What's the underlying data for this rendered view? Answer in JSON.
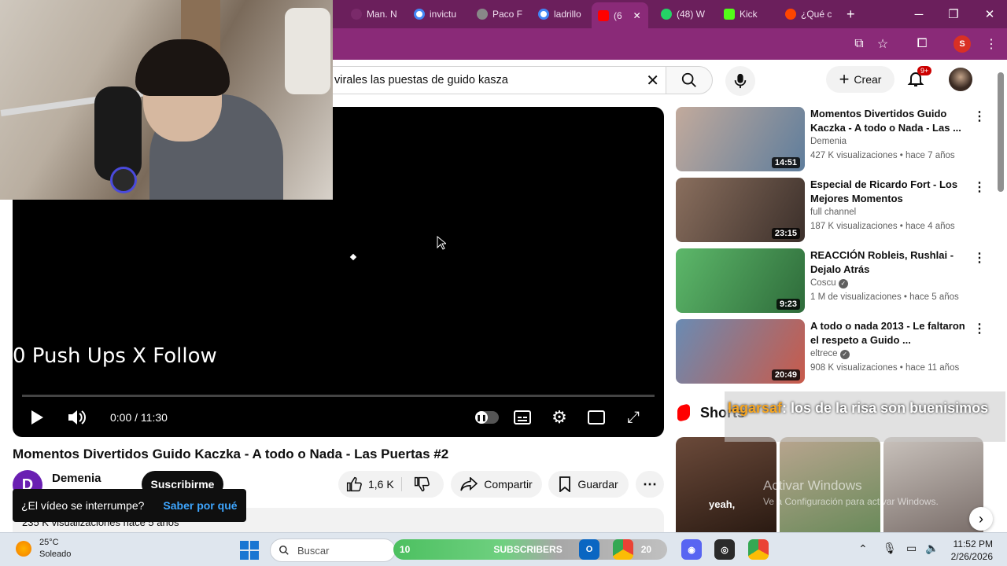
{
  "browser": {
    "tabs": [
      {
        "label": "Man. N",
        "color": "#7a2a6a"
      },
      {
        "label": "invictu",
        "color": "#4285f4"
      },
      {
        "label": "Paco F",
        "color": "#888888"
      },
      {
        "label": "ladrillo",
        "color": "#4285f4"
      },
      {
        "label": "(6",
        "color": "#ff0000"
      },
      {
        "label": "(48) W",
        "color": "#25d366"
      },
      {
        "label": "Kick",
        "color": "#53fc18"
      },
      {
        "label": "¿Qué c",
        "color": "#ff4500"
      }
    ],
    "profile_letter": "S"
  },
  "youtube": {
    "search_value": "virales las puestas de guido kasza",
    "create_label": "Crear",
    "notif_badge": "9+"
  },
  "player": {
    "overlay_text": "0 Push Ups X Follow",
    "time": "0:00 / 11:30"
  },
  "video": {
    "title": "Momentos Divertidos Guido Kaczka - A todo o Nada - Las Puertas #2",
    "channel": "Demenia",
    "subscribe_label": "Suscribirme",
    "likes": "1,6 K",
    "share_label": "Compartir",
    "save_label": "Guardar",
    "views_partial": "235 K visualizaciones  hace 5 años",
    "toast_text": "¿El vídeo se interrumpe?",
    "toast_link": "Saber por qué"
  },
  "recommended": [
    {
      "title": "Momentos Divertidos Guido Kaczka - A todo o Nada - Las ...",
      "channel": "Demenia",
      "verified": false,
      "meta": "427 K visualizaciones • hace 7 años",
      "duration": "14:51",
      "colors": [
        "#b8a59a",
        "#5e7d9c"
      ]
    },
    {
      "title": "Especial de Ricardo Fort - Los Mejores Momentos",
      "channel": "full channel",
      "verified": false,
      "meta": "187 K visualizaciones • hace 4 años",
      "duration": "23:15",
      "colors": [
        "#8a6f5e",
        "#3b2f2a"
      ]
    },
    {
      "title": "REACCIÓN Robleis, Rushlai - Dejalo Atrás",
      "channel": "Coscu",
      "verified": true,
      "meta": "1 M de visualizaciones • hace 5 años",
      "duration": "9:23",
      "colors": [
        "#5db86a",
        "#2e6b3a"
      ]
    },
    {
      "title": "A todo o nada 2013 - Le faltaron el respeto a Guido ...",
      "channel": "eltrece",
      "verified": true,
      "meta": "908 K visualizaciones • hace 11 años",
      "duration": "20:49",
      "colors": [
        "#6a8bb3",
        "#c95a4a"
      ]
    }
  ],
  "shorts": {
    "label": "Shorts",
    "items": [
      {
        "caption": "yeah,",
        "colors": [
          "#3a2a20",
          "#6b4a3a"
        ]
      },
      {
        "caption": "",
        "colors": [
          "#b9a58f",
          "#6a8a5a"
        ]
      },
      {
        "caption": "",
        "colors": [
          "#7a6e6a",
          "#c9c2bc"
        ]
      }
    ]
  },
  "chat_overlay": {
    "user": "lagarsaf",
    "message": ": los de la risa son buenisimos"
  },
  "windows_watermark": {
    "line1": "Activar Windows",
    "line2": "Ve a Configuración para activar Windows."
  },
  "taskbar": {
    "weather_temp": "25°C",
    "weather_desc": "Soleado",
    "search_placeholder": "Buscar",
    "subs_count": "10",
    "subs_label": "SUBSCRIBERS",
    "badge_20": "20",
    "time": "11:52 PM",
    "date": "2/26/2026"
  }
}
